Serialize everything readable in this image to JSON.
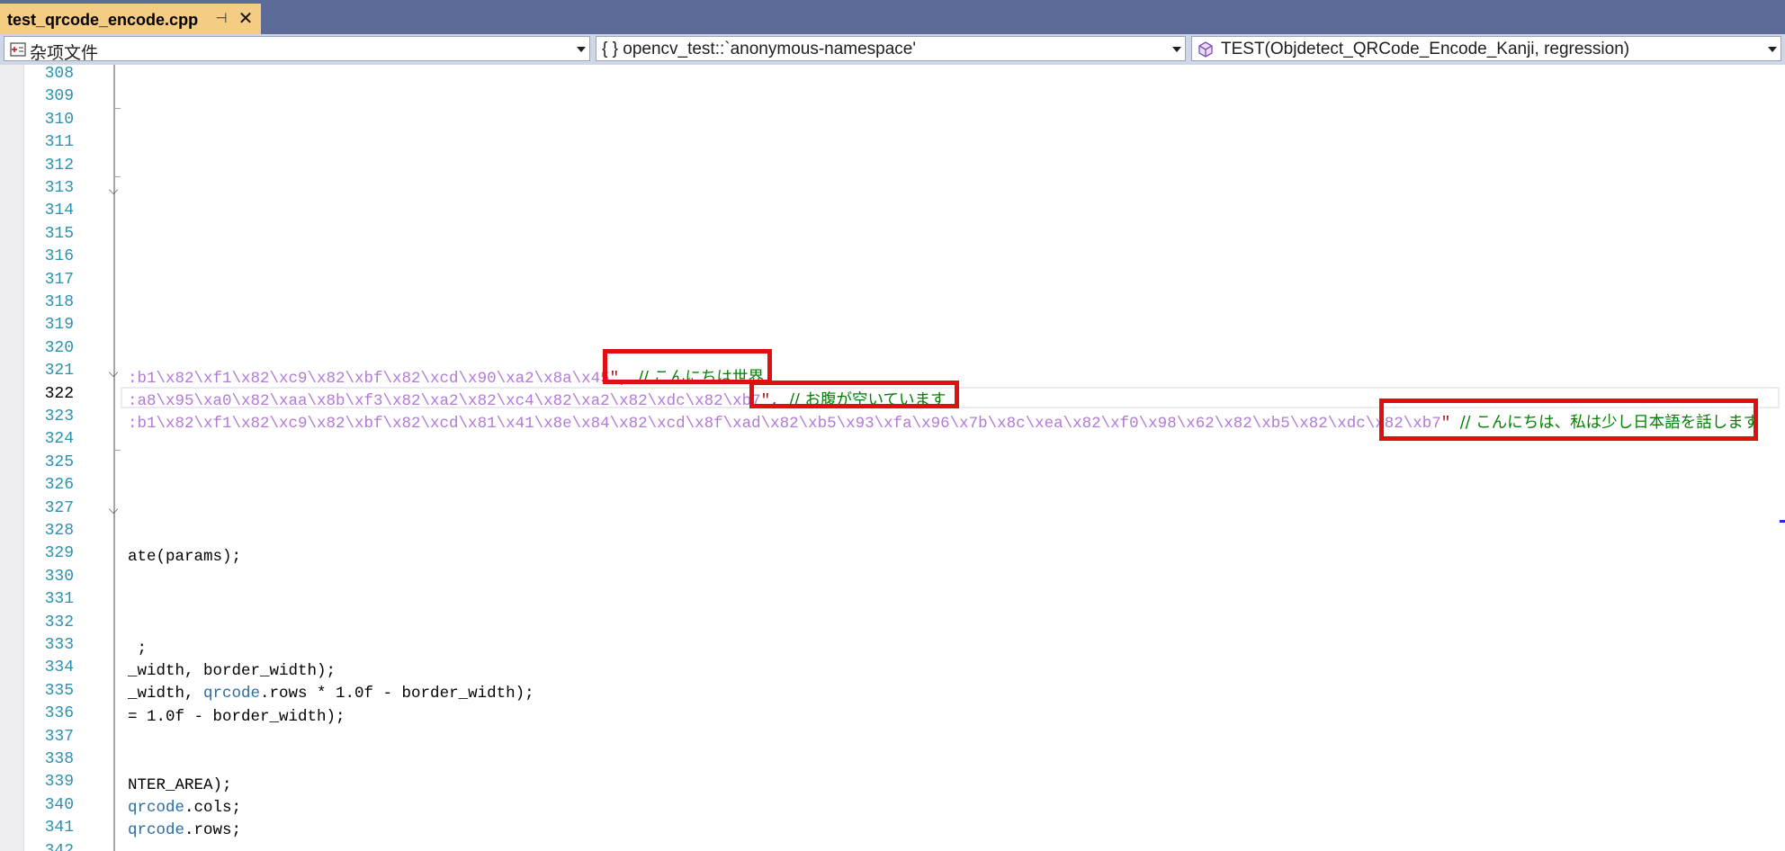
{
  "tab": {
    "title": "test_qrcode_encode.cpp",
    "pin_glyph": "⊣",
    "close_glyph": "✕"
  },
  "navbar": {
    "project_dropdown": {
      "label": "杂项文件",
      "icon": "misc-files-icon"
    },
    "scope_dropdown": {
      "label": "{ } opencv_test::`anonymous-namespace'"
    },
    "member_dropdown": {
      "label": "TEST(Objdetect_QRCode_Encode_Kanji, regression)",
      "icon": "cube-icon"
    }
  },
  "editor": {
    "current_line": "322",
    "line_numbers": [
      "308",
      "309",
      "310",
      "311",
      "312",
      "313",
      "314",
      "315",
      "316",
      "317",
      "318",
      "319",
      "320",
      "321",
      "322",
      "323",
      "324",
      "325",
      "326",
      "327",
      "328",
      "329",
      "330",
      "331",
      "332",
      "333",
      "334",
      "335",
      "336",
      "337",
      "338",
      "339",
      "340",
      "341",
      "342"
    ],
    "lines": {
      "l321_escape": ":b1\\x82\\xf1\\x82\\xc9\\x82\\xbf\\x82\\xcd\\x90\\xa2\\x8a\\x45",
      "l321_end": "\",",
      "l321_comment": "// こんにちは世界",
      "l322_escape": ":a8\\x95\\xa0\\x82\\xaa\\x8b\\xf3\\x82\\xa2\\x82\\xc4\\x82\\xa2\\x82\\xdc\\x82\\xb7",
      "l322_end": "\",",
      "l322_comment": "// お腹が空いています",
      "l323_escape": ":b1\\x82\\xf1\\x82\\xc9\\x82\\xbf\\x82\\xcd\\x81\\x41\\x8e\\x84\\x82\\xcd\\x8f\\xad\\x82\\xb5\\x93\\xfa\\x96\\x7b\\x8c\\xea\\x82\\xf0\\x98\\x62\\x82\\xb5\\x82\\xdc\\x82\\xb7",
      "l323_end": "\"",
      "l323_comment": "// こんにちは、私は少し日本語を話します",
      "l329": "ate(params);",
      "l333": " ;",
      "l334": "_width, border_width);",
      "l335_a": "_width, ",
      "l335_cls": "qrcode",
      "l335_b": ".rows * 1.0f - border_width);",
      "l336": "= 1.0f - border_width);",
      "l339": "NTER_AREA);",
      "l340_cls": "qrcode",
      "l340_b": ".cols;",
      "l341_cls": "qrcode",
      "l341_b": ".rows;"
    }
  }
}
